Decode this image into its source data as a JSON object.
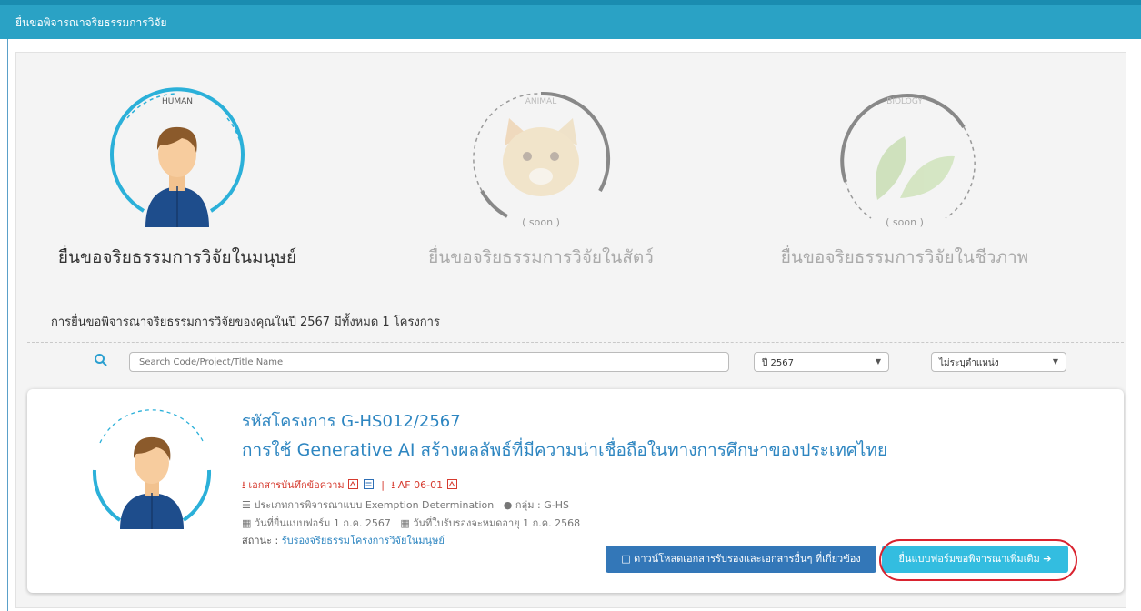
{
  "header": {
    "title": "ยื่นขอพิจารณาจริยธรรมการวิจัย"
  },
  "types": [
    {
      "tag": "HUMAN",
      "label": "ยื่นขอจริยธรรมการวิจัยในมนุษย์",
      "soon": ""
    },
    {
      "tag": "ANIMAL",
      "label": "ยื่นขอจริยธรรมการวิจัยในสัตว์",
      "soon": "( soon )"
    },
    {
      "tag": "BIOLOGY",
      "label": "ยื่นขอจริยธรรมการวิจัยในชีวภาพ",
      "soon": "( soon )"
    }
  ],
  "summary": "การยื่นขอพิจารณาจริยธรรมการวิจัยของคุณในปี 2567 มีทั้งหมด 1 โครงการ",
  "filters": {
    "search_placeholder": "Search Code/Project/Title Name",
    "year": "ปี 2567",
    "position": "ไม่ระบุตำแหน่ง"
  },
  "project": {
    "code": "รหัสโครงการ G-HS012/2567",
    "title": "การใช้ Generative AI สร้างผลลัพธ์ที่มีความน่าเชื่อถือในทางการศึกษาของประเทศไทย",
    "memo_link": "เอกสารบันทึกข้อความ",
    "af_link": "AF 06-01",
    "review_type": "ประเภทการพิจารณาแบบ Exemption Determination",
    "group": "กลุ่ม : G-HS",
    "submit_date": "วันที่ยื่นแบบฟอร์ม 1 ก.ค. 2567",
    "expire_date": "วันที่ใบรับรองจะหมดอายุ 1 ก.ค. 2568",
    "status_label": "สถานะ :",
    "status_value": "รับรองจริยธรรมโครงการวิจัยในมนุษย์",
    "download_button": "ดาวน์โหลดเอกสารรับรองและเอกสารอื่นๆ ที่เกี่ยวข้อง",
    "resubmit_button": "ยื่นแบบฟอร์มขอพิจารณาเพิ่มเติม"
  },
  "colors": {
    "header": "#2aa2c5",
    "link": "#2e86c1",
    "danger": "#d63b2f",
    "accent": "#33bde0"
  }
}
